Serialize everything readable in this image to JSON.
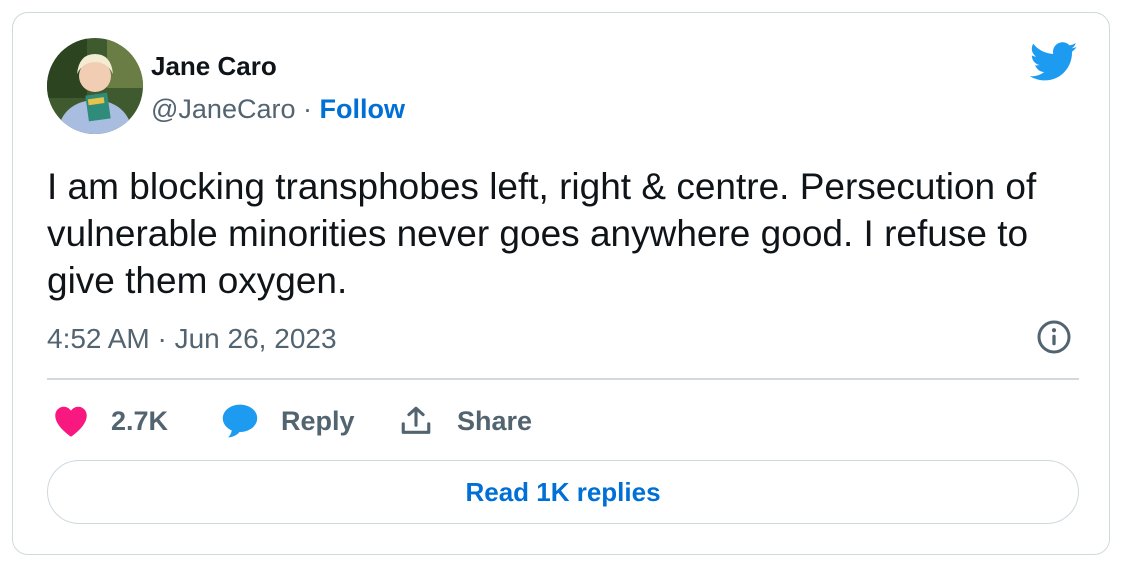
{
  "tweet": {
    "author_name": "Jane Caro",
    "handle": "@JaneCaro",
    "separator": "·",
    "follow_label": "Follow",
    "text": "I am blocking transphobes left, right & centre. Persecution of vulnerable minorities never goes anywhere good. I refuse to give them oxygen.",
    "timestamp": "4:52 AM · Jun 26, 2023",
    "likes": "2.7K",
    "reply_label": "Reply",
    "share_label": "Share",
    "read_replies_label": "Read 1K replies"
  },
  "icons": {
    "brand": "twitter-bird-icon",
    "info": "info-icon",
    "like": "heart-icon",
    "reply": "speech-bubble-icon",
    "share": "share-upload-icon"
  },
  "colors": {
    "brand_blue": "#1d9bf0",
    "link_blue": "#006fd6",
    "heart_pink": "#f91880",
    "text_primary": "#0f1419",
    "text_secondary": "#536471",
    "border": "#cfd9de"
  }
}
